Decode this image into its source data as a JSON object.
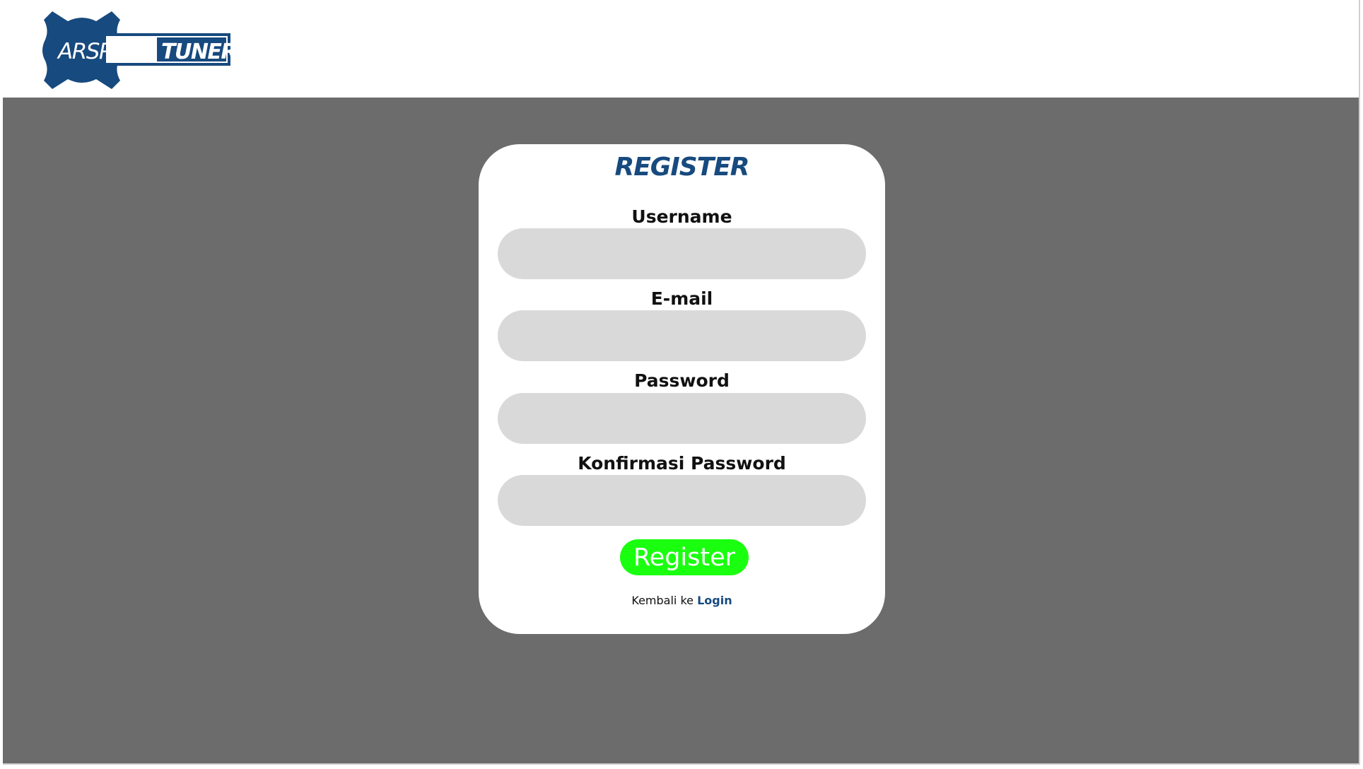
{
  "brand": {
    "name_part1": "ARSPEED",
    "name_part2": "TUNER",
    "color": "#174a7e"
  },
  "form": {
    "title": "REGISTER",
    "fields": [
      {
        "label": "Username",
        "value": "",
        "placeholder": ""
      },
      {
        "label": "E-mail",
        "value": "",
        "placeholder": ""
      },
      {
        "label": "Password",
        "value": "",
        "placeholder": ""
      },
      {
        "label": "Konfirmasi Password",
        "value": "",
        "placeholder": ""
      }
    ],
    "submit_label": "Register",
    "submit_color": "#1aff0f",
    "back_text": "Kembali ke",
    "back_link": "Login"
  },
  "colors": {
    "background": "#6c6c6c",
    "input_fill": "#d9d9d9"
  }
}
